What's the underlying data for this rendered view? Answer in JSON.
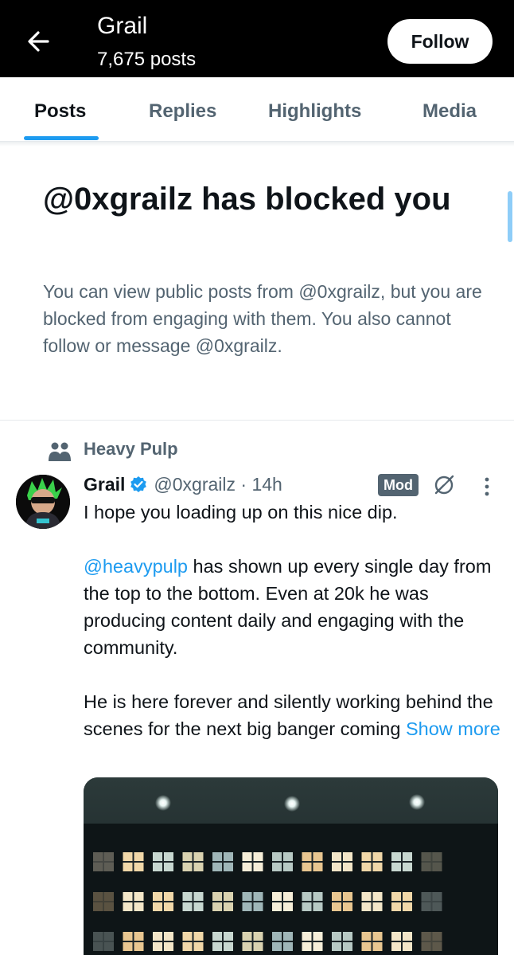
{
  "header": {
    "title": "Grail",
    "post_count": "7,675 posts",
    "back_icon": "arrow-left-icon",
    "follow_label": "Follow"
  },
  "tabs": [
    {
      "label": "Posts",
      "active": true
    },
    {
      "label": "Replies",
      "active": false
    },
    {
      "label": "Highlights",
      "active": false
    },
    {
      "label": "Media",
      "active": false
    }
  ],
  "blocked_notice": {
    "title": "@0xgrailz has blocked you",
    "description": "You can view public posts from @0xgrailz, but you are blocked from engaging with them. You also cannot follow or message @0xgrailz."
  },
  "post": {
    "community": {
      "icon": "people-icon",
      "name": "Heavy Pulp"
    },
    "author_name": "Grail",
    "verified_icon": "verified-badge-icon",
    "handle_time": "@0xgrailz · 14h",
    "badge": "Mod",
    "grok_icon": "grok-icon",
    "more_icon": "more-vertical-icon",
    "text_line1": "I hope you loading up on this nice dip.",
    "mention": "@heavypulp",
    "text_para2": " has shown up every single day from the top to the bottom. Even at 20k he was producing content daily and engaging with the community.",
    "text_para3": "He is here forever and silently working behind the scenes for the next big banger coming",
    "show_more": "Show more",
    "colors": {
      "accent": "#1d9bf0",
      "muted": "#536471",
      "text": "#0f1419",
      "header_bg": "#000000"
    }
  }
}
